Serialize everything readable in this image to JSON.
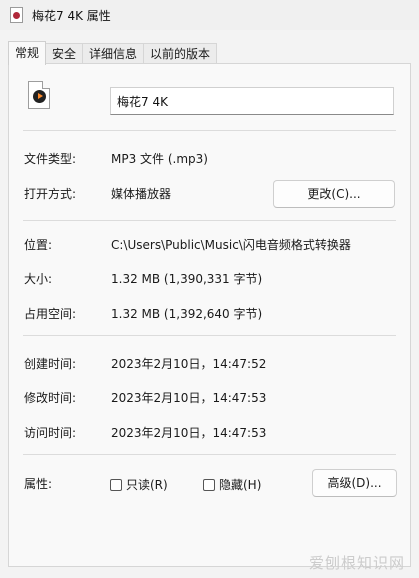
{
  "window": {
    "title": "梅花7 4K 属性"
  },
  "tabs": [
    {
      "label": "常规",
      "active": true
    },
    {
      "label": "安全",
      "active": false
    },
    {
      "label": "详细信息",
      "active": false
    },
    {
      "label": "以前的版本",
      "active": false
    }
  ],
  "general": {
    "file_icon": "audio-file-icon",
    "file_name": "梅花7 4K",
    "file_type_label": "文件类型:",
    "file_type_value": "MP3 文件 (.mp3)",
    "open_with_label": "打开方式:",
    "open_with_value": "媒体播放器",
    "change_button": "更改(C)...",
    "location_label": "位置:",
    "location_value": "C:\\Users\\Public\\Music\\闪电音频格式转换器",
    "size_label": "大小:",
    "size_value": "1.32 MB (1,390,331 字节)",
    "size_on_disk_label": "占用空间:",
    "size_on_disk_value": "1.32 MB (1,392,640 字节)",
    "created_label": "创建时间:",
    "created_value": "2023年2月10日，14:47:52",
    "modified_label": "修改时间:",
    "modified_value": "2023年2月10日，14:47:53",
    "accessed_label": "访问时间:",
    "accessed_value": "2023年2月10日，14:47:53",
    "attributes_label": "属性:",
    "readonly_label": "只读(R)",
    "readonly_checked": false,
    "hidden_label": "隐藏(H)",
    "hidden_checked": false,
    "advanced_button": "高级(D)..."
  },
  "watermark": "爱刨根知识网"
}
